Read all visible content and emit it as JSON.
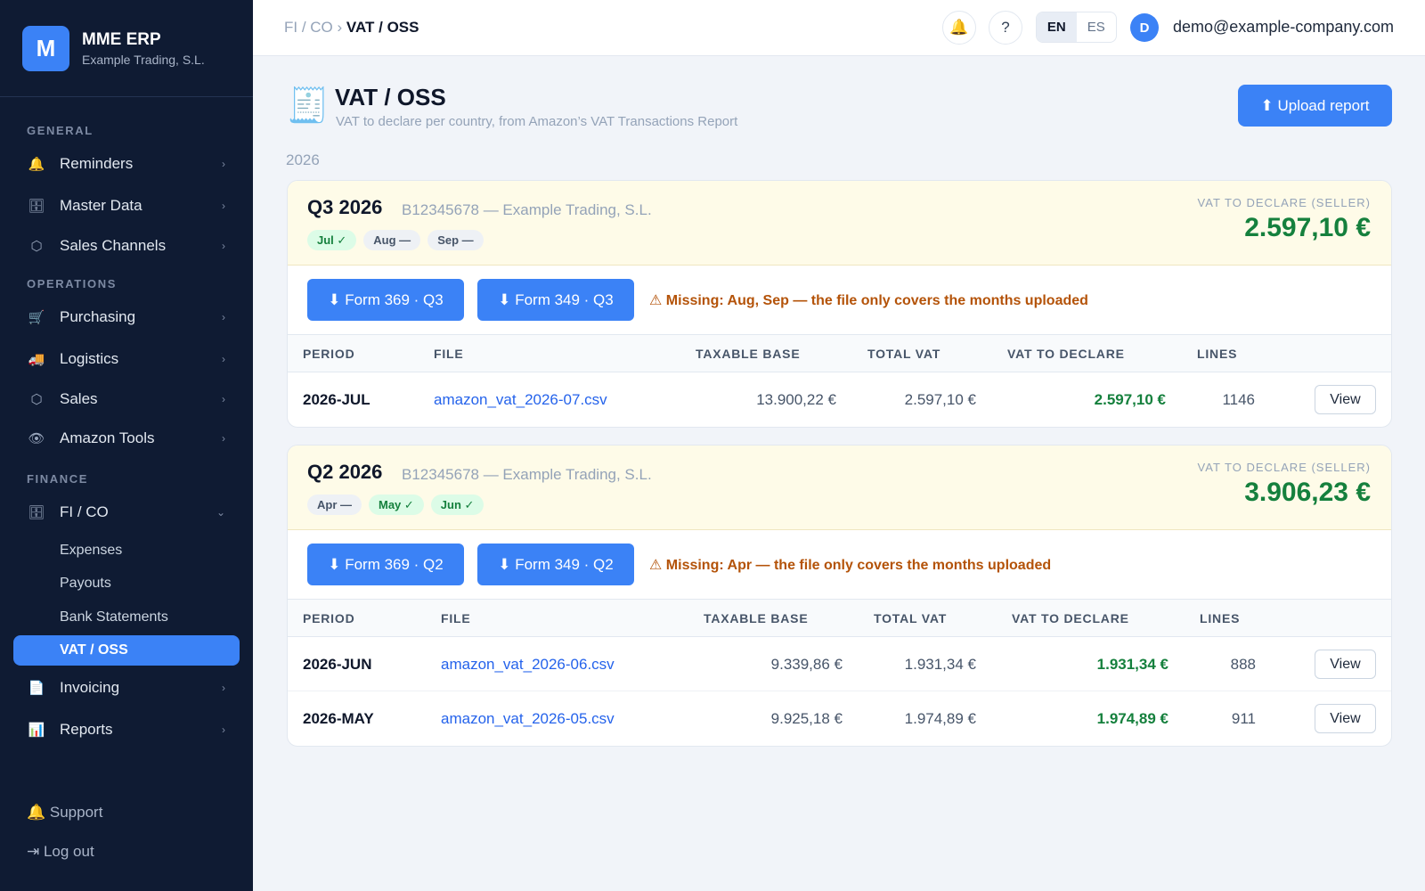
{
  "brand": {
    "logo_letter": "M",
    "name": "MME ERP",
    "company": "Example Trading, S.L."
  },
  "sidebar": {
    "sections": {
      "general": "GENERAL",
      "operations": "OPERATIONS",
      "finance": "FINANCE"
    },
    "items": [
      {
        "label": "Reminders",
        "icon": "bell-icon",
        "glyph": "🔔"
      },
      {
        "label": "Master Data",
        "icon": "cabinet-icon",
        "glyph": "🗄"
      },
      {
        "label": "Sales Channels",
        "icon": "hexagon-icon",
        "glyph": "⬡"
      },
      {
        "label": "Purchasing",
        "icon": "cart-icon",
        "glyph": "🛒"
      },
      {
        "label": "Logistics",
        "icon": "truck-icon",
        "glyph": "🚚"
      },
      {
        "label": "Sales",
        "icon": "hexagon-icon",
        "glyph": "⬡"
      },
      {
        "label": "Amazon Tools",
        "icon": "eye-icon",
        "glyph": "👁"
      },
      {
        "label": "FI / CO",
        "icon": "cabinet-icon",
        "glyph": "🗄"
      },
      {
        "label": "Invoicing",
        "icon": "document-icon",
        "glyph": "📄"
      },
      {
        "label": "Reports",
        "icon": "bar-chart-icon",
        "glyph": "📊"
      }
    ],
    "fico_sub": [
      "Expenses",
      "Payouts",
      "Bank Statements",
      "VAT / OSS"
    ],
    "chevron_right": "›",
    "chevron_down": "⌄",
    "footer": {
      "support": "🔔 Support",
      "logout": "⇥ Log out"
    }
  },
  "topbar": {
    "breadcrumb_parent": "FI / CO",
    "breadcrumb_sep": "›",
    "breadcrumb_current": "VAT / OSS",
    "bell": "🔔",
    "help": "?",
    "lang_en": "EN",
    "lang_es": "ES",
    "avatar_letter": "D",
    "email": "demo@example-company.com"
  },
  "page": {
    "icon": "🧾",
    "title": "VAT / OSS",
    "subtitle": "VAT to declare per country, from Amazon’s VAT Transactions Report",
    "upload_label": "⬆ Upload report",
    "year": "2026"
  },
  "columns": {
    "period": "PERIOD",
    "file": "FILE",
    "base": "TAXABLE BASE",
    "total": "TOTAL VAT",
    "declare": "VAT TO DECLARE",
    "lines": "LINES"
  },
  "sum_label": "VAT TO DECLARE (SELLER)",
  "view_label": "View",
  "quarters": [
    {
      "title": "Q3 2026",
      "entity": "B12345678 — Example Trading, S.L.",
      "months": [
        {
          "label": "Jul ✓",
          "ok": true
        },
        {
          "label": "Aug —",
          "ok": false
        },
        {
          "label": "Sep —",
          "ok": false
        }
      ],
      "total": "2.597,10 €",
      "form369": "⬇ Form 369 · Q3",
      "form349": "⬇ Form 349 · Q3",
      "warning": "⚠ Missing: Aug, Sep — the file only covers the months uploaded",
      "rows": [
        {
          "period": "2026-JUL",
          "file": "amazon_vat_2026-07.csv",
          "base": "13.900,22 €",
          "total": "2.597,10 €",
          "declare": "2.597,10 €",
          "lines": "1146"
        }
      ]
    },
    {
      "title": "Q2 2026",
      "entity": "B12345678 — Example Trading, S.L.",
      "months": [
        {
          "label": "Apr —",
          "ok": false
        },
        {
          "label": "May ✓",
          "ok": true
        },
        {
          "label": "Jun ✓",
          "ok": true
        }
      ],
      "total": "3.906,23 €",
      "form369": "⬇ Form 369 · Q2",
      "form349": "⬇ Form 349 · Q2",
      "warning": "⚠ Missing: Apr — the file only covers the months uploaded",
      "rows": [
        {
          "period": "2026-JUN",
          "file": "amazon_vat_2026-06.csv",
          "base": "9.339,86 €",
          "total": "1.931,34 €",
          "declare": "1.931,34 €",
          "lines": "888"
        },
        {
          "period": "2026-MAY",
          "file": "amazon_vat_2026-05.csv",
          "base": "9.925,18 €",
          "total": "1.974,89 €",
          "declare": "1.974,89 €",
          "lines": "911"
        }
      ]
    }
  ]
}
